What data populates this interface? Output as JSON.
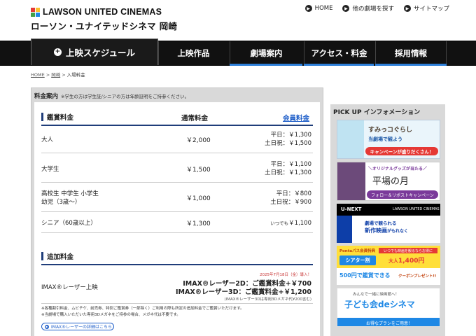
{
  "header": {
    "logo_en": "LAWSON UNITED CINEMAS",
    "logo_jp": "ローソン・ユナイテッドシネマ 岡崎",
    "topnav": [
      "HOME",
      "他の劇場を探す",
      "サイトマップ"
    ]
  },
  "nav": {
    "schedule": "上映スケジュール",
    "works": "上映作品",
    "theater": "劇場案内",
    "access": "アクセス・料金",
    "membership": "採用情報"
  },
  "breadcrumb": {
    "home": "HOME",
    "theater": "岡崎",
    "current": "入場料金",
    "sep": ">"
  },
  "pricing": {
    "title": "料金案内",
    "title_note": "※学生の方は学生証/シニアの方は年齢証明をご持参ください。",
    "section1": "鑑賞料金",
    "col_normal": "通常料金",
    "col_member": "会員料金",
    "rows": [
      {
        "label": "大人",
        "normal": "￥2,000",
        "m1": "平日：￥1,300",
        "m2": "土日祝：￥1,500"
      },
      {
        "label": "大学生",
        "normal": "￥1,500",
        "m1": "平日：￥1,100",
        "m2": "土日祝：￥1,300"
      },
      {
        "label": "高校生 中学生 小学生",
        "label2": "幼児（3歳〜）",
        "normal": "￥1,000",
        "m1": "平日：￥800",
        "m2": "土日祝：￥900"
      },
      {
        "label": "シニア（60歳以上）",
        "normal": "￥1,300",
        "m1_prefix": "いつでも",
        "m1": "￥1,100"
      }
    ],
    "section2": "追加料金",
    "imax_label": "IMAX®レーザー上映",
    "imax_intro": "2025年7月18日（金）導入！",
    "imax_2d": "IMAX®レーザー2D：ご鑑賞料金+￥700",
    "imax_3d": "IMAX®レーザー3D：ご鑑賞料金+￥1,200",
    "imax_3d_note": "(IMAX®レーザー3Dは専用3Dメガネ代¥200含む)",
    "note1": "※各種割引料金、ムビチケ、前売券、特別ご鑑賞券（一部除く）ご利用の際も所定の追加料金でご鑑賞いただけます。",
    "note2": "※当劇場で購入いただいた専用3Dメガネをご持参の場合、メガネ代は不要です。",
    "imax_link": "IMAX®レーザーの詳細はこちら"
  },
  "pickup": {
    "title": "PICK UP インフォメーション",
    "b1_title": "すみっコぐらし",
    "b1_sub": "当劇場で観よう",
    "b1_cta": "キャンペーンが盛りだくさん！",
    "b2_top": "＼オリジナルグッズが当たる／",
    "b2_title": "平場の月",
    "b2_cta": "フォロー＆リポストキャンペーン",
    "b3_top_left": "U-NEXT",
    "b3_top_right": "LAWSON UNITED CINEMAS",
    "b3_line1": "劇場で観られる",
    "b3_line2": "新作映画",
    "b3_line2b": "がもれなく",
    "b4_top": "Pontaパス会員特典",
    "b4_sub": "いつでも映画を観るならお得に",
    "b4_theater": "シアター割",
    "b4_adult": "大人",
    "b4_price": "1,400円",
    "b4_line2": "500円で鑑賞できる",
    "b4_line2b": "クーポンプレゼント!!",
    "b5_top": "みんなで一緒に映画館へ！",
    "b5_title": "子ども会deシネマ",
    "b5_cta": "お得なプランをご用意！"
  },
  "colors": {
    "nav_bg": "#111111",
    "accent_blue": "#2d7fd9",
    "section_bar": "#1f3d7a",
    "member_link": "#1f5fc9",
    "imax_red": "#c73232"
  }
}
